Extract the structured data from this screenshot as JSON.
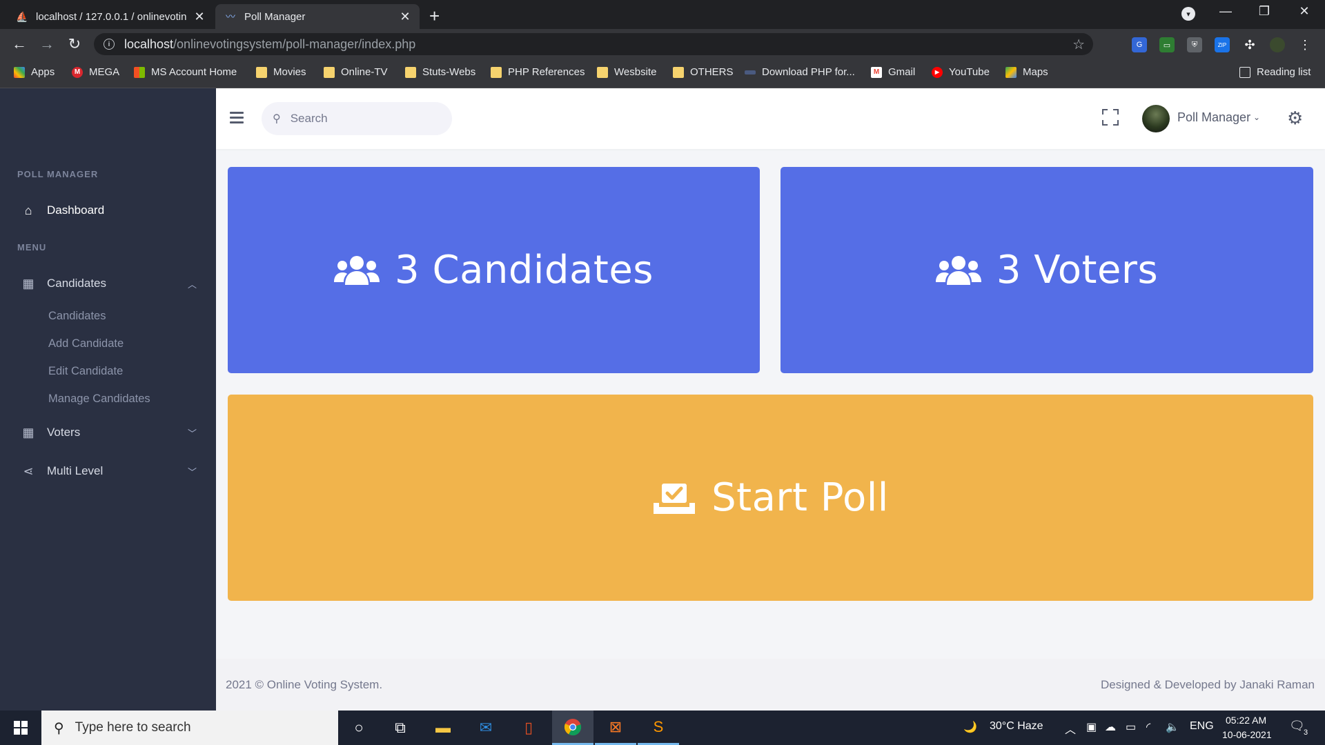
{
  "browser": {
    "tabs": [
      {
        "title": "localhost / 127.0.0.1 / onlinevotin",
        "active": false
      },
      {
        "title": "Poll Manager",
        "active": true
      }
    ],
    "url_host": "localhost",
    "url_path": "/onlinevotingsystem/poll-manager/index.php",
    "bookmarks": [
      "Apps",
      "MEGA",
      "MS Account Home",
      "Movies",
      "Online-TV",
      "Stuts-Webs",
      "PHP References",
      "Wesbsite",
      "OTHERS",
      "Download PHP for...",
      "Gmail",
      "YouTube",
      "Maps"
    ],
    "reading_list": "Reading list"
  },
  "sidebar": {
    "section_title": "POLL MANAGER",
    "dashboard": "Dashboard",
    "menu_title": "MENU",
    "candidates": {
      "label": "Candidates",
      "sub": [
        "Candidates",
        "Add Candidate",
        "Edit Candidate",
        "Manage Candidates"
      ]
    },
    "voters": "Voters",
    "multi_level": "Multi Level"
  },
  "header": {
    "search_placeholder": "Search",
    "user_name": "Poll Manager"
  },
  "cards": {
    "candidates": "3 Candidates",
    "voters": "3 Voters",
    "start_poll": "Start Poll"
  },
  "footer": {
    "left": "2021 © Online Voting System.",
    "right": "Designed & Developed by Janaki Raman"
  },
  "taskbar": {
    "search_placeholder": "Type here to search",
    "weather": "30°C  Haze",
    "lang": "ENG",
    "time": "05:22 AM",
    "date": "10-06-2021",
    "notifications": "3"
  },
  "colors": {
    "sidebar": "#2a3042",
    "card_blue": "#556ee6",
    "card_orange": "#f1b44c"
  }
}
